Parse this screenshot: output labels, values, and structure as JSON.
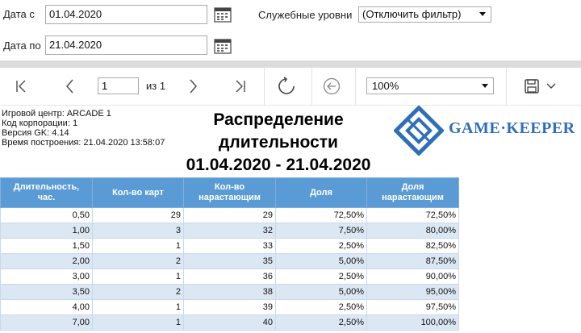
{
  "filters": {
    "date_from_label": "Дата с",
    "date_from_value": "01.04.2020",
    "date_to_label": "Дата по",
    "date_to_value": "21.04.2020",
    "service_levels_label": "Служебные уровни",
    "service_levels_value": "(Отключить фильтр)"
  },
  "toolbar": {
    "page_value": "1",
    "page_of": "из 1",
    "zoom_value": "100%"
  },
  "report": {
    "meta": [
      "Игровой центр: ARCADE 1",
      "Код корпорации: 1",
      "Версия GK: 4.14",
      "Время построения: 21.04.2020 13:58:07"
    ],
    "title_line1": "Распределение",
    "title_line2": "длительности",
    "title_line3": "01.04.2020 - 21.04.2020",
    "logo_text": "GAME·KEEPER",
    "brand_color": "#2f6fb6",
    "header_color": "#5b9bd5"
  },
  "table": {
    "columns": [
      "Длительность, час.",
      "Кол-во карт",
      "Кол-во нарастающим",
      "Доля",
      "Доля нарастающим"
    ],
    "rows": [
      [
        "0,50",
        "29",
        "29",
        "72,50%",
        "72,50%"
      ],
      [
        "1,00",
        "3",
        "32",
        "7,50%",
        "80,00%"
      ],
      [
        "1,50",
        "1",
        "33",
        "2,50%",
        "82,50%"
      ],
      [
        "2,00",
        "2",
        "35",
        "5,00%",
        "87,50%"
      ],
      [
        "3,00",
        "1",
        "36",
        "2,50%",
        "90,00%"
      ],
      [
        "3,50",
        "2",
        "38",
        "5,00%",
        "95,00%"
      ],
      [
        "4,00",
        "1",
        "39",
        "2,50%",
        "97,50%"
      ],
      [
        "7,00",
        "1",
        "40",
        "2,50%",
        "100,00%"
      ]
    ]
  }
}
